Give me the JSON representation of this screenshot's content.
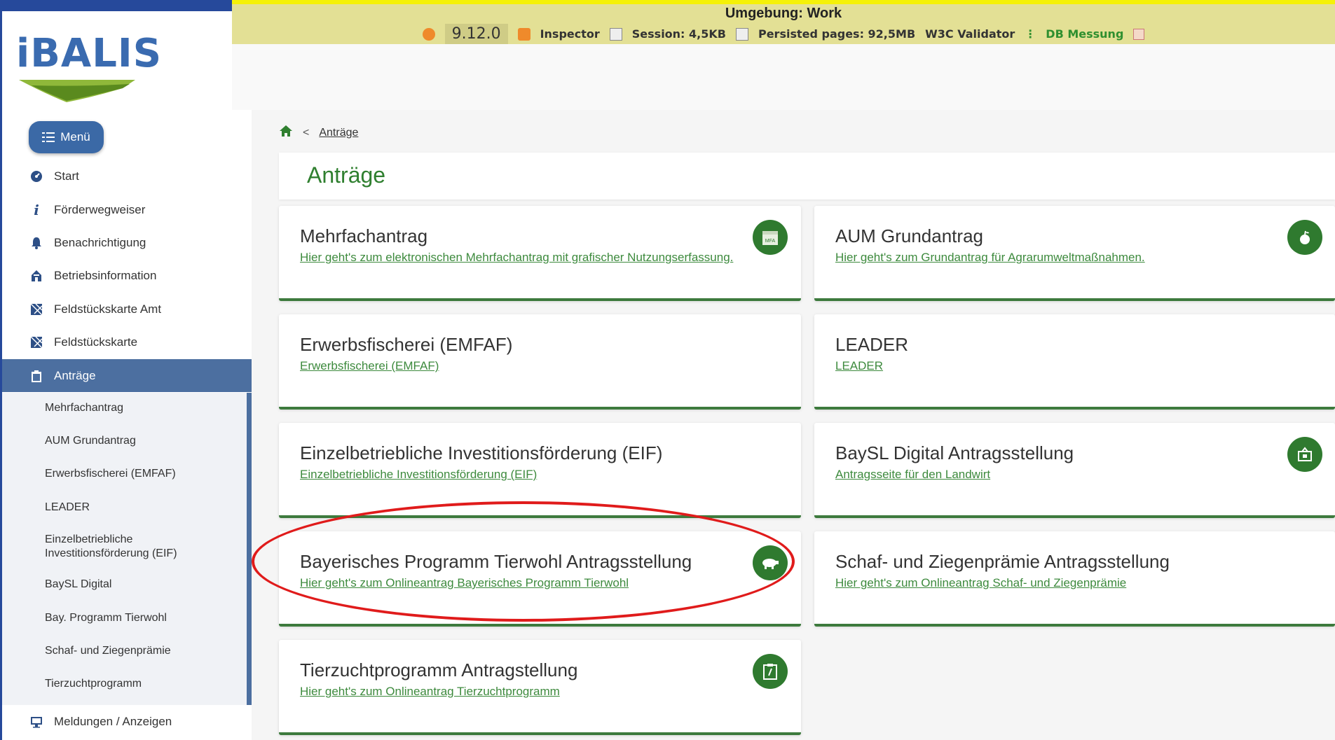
{
  "env": {
    "title": "Umgebung: Work",
    "version": "9.12.0",
    "inspector": "Inspector",
    "session": "Session: 4,5KB",
    "persisted": "Persisted pages: 92,5MB",
    "validator": "W3C Validator",
    "db": "DB Messung"
  },
  "logo": {
    "text": "iBALIS"
  },
  "sidebar": {
    "menu_label": "Menü",
    "items": [
      {
        "label": "Start",
        "icon": "dashboard-icon"
      },
      {
        "label": "Förderwegweiser",
        "icon": "info-icon"
      },
      {
        "label": "Benachrichtigung",
        "icon": "bell-icon"
      },
      {
        "label": "Betriebsinformation",
        "icon": "building-icon"
      },
      {
        "label": "Feldstückskarte Amt",
        "icon": "map-icon"
      },
      {
        "label": "Feldstückskarte",
        "icon": "map-icon"
      },
      {
        "label": "Anträge",
        "icon": "clipboard-icon"
      }
    ],
    "sub_items": [
      "Mehrfachantrag",
      "AUM Grundantrag",
      "Erwerbsfischerei (EMFAF)",
      "LEADER",
      "Einzelbetriebliche Investitionsförderung (EIF)",
      "BaySL Digital",
      "Bay. Programm Tierwohl",
      "Schaf- und Ziegenprämie",
      "Tierzuchtprogramm"
    ],
    "bottom_item": {
      "label": "Meldungen / Anzeigen",
      "icon": "monitor-icon"
    }
  },
  "breadcrumb": {
    "current": "Anträge"
  },
  "page_title": "Anträge",
  "cards": [
    {
      "title": "Mehrfachantrag",
      "link": "Hier geht's zum elektronischen Mehrfachantrag mit grafischer Nutzungserfassung.",
      "icon": "mfa-calendar-icon"
    },
    {
      "title": "AUM Grundantrag",
      "link": "Hier geht's zum Grundantrag für Agrarumweltmaßnahmen.",
      "icon": "apple-icon"
    },
    {
      "title": "Erwerbsfischerei (EMFAF)",
      "link": "Erwerbsfischerei (EMFAF)",
      "icon": ""
    },
    {
      "title": "LEADER",
      "link": "LEADER",
      "icon": ""
    },
    {
      "title": "Einzelbetriebliche Investitionsförderung (EIF)",
      "link": "Einzelbetriebliche Investitionsförderung (EIF)",
      "icon": ""
    },
    {
      "title": "BaySL Digital Antragsstellung",
      "link": "Antragsseite für den Landwirt",
      "icon": "scale-icon"
    },
    {
      "title": "Bayerisches Programm Tierwohl Antragsstellung",
      "link": "Hier geht's zum Onlineantrag Bayerisches Programm Tierwohl",
      "icon": "pig-icon"
    },
    {
      "title": "Schaf- und Ziegenprämie Antragsstellung",
      "link": "Hier geht's zum Onlineantrag Schaf- und Ziegenprämie",
      "icon": ""
    },
    {
      "title": "Tierzuchtprogramm Antragstellung",
      "link": "Hier geht's zum Onlineantrag Tierzuchtprogramm",
      "icon": "clipboard-icon"
    }
  ],
  "colors": {
    "accent_green": "#2f7a2f",
    "nav_blue": "#4c6fa0",
    "env_yellow": "#f5f107",
    "highlight_red": "#e01b1b"
  }
}
